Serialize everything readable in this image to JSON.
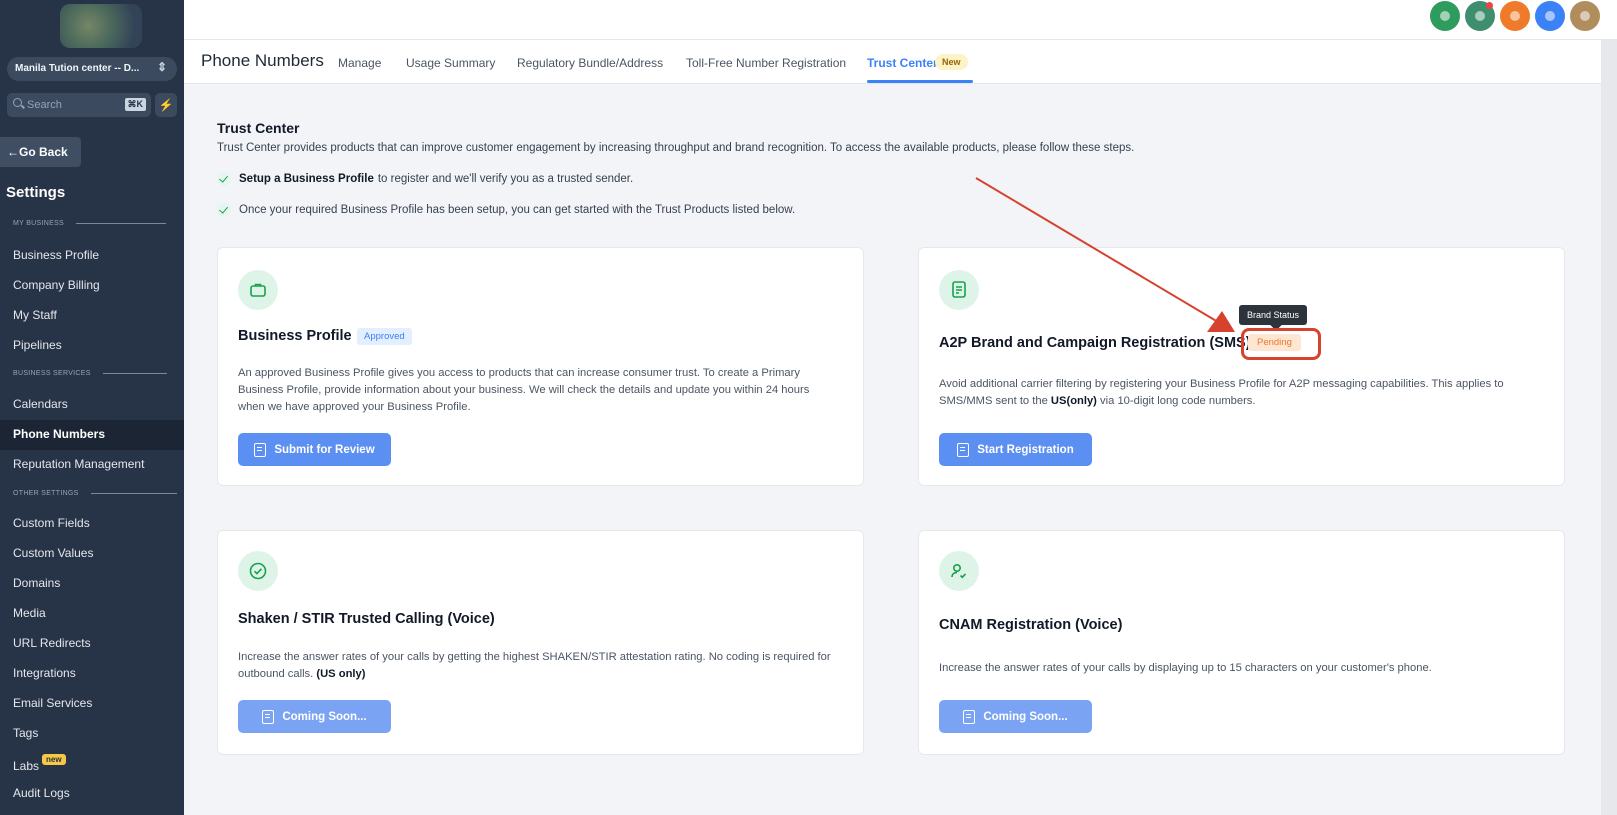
{
  "sidebar": {
    "account": "Manila Tution center -- D...",
    "search_placeholder": "Search",
    "search_shortcut": "⌘K",
    "go_back": "Go Back",
    "title": "Settings",
    "sections": {
      "my_business": "MY BUSINESS",
      "business_services": "BUSINESS SERVICES",
      "other_settings": "OTHER SETTINGS"
    },
    "items": [
      "Business Profile",
      "Company Billing",
      "My Staff",
      "Pipelines",
      "Calendars",
      "Phone Numbers",
      "Reputation Management",
      "Custom Fields",
      "Custom Values",
      "Domains",
      "Media",
      "URL Redirects",
      "Integrations",
      "Email Services",
      "Tags",
      "Labs",
      "Audit Logs"
    ],
    "labs_badge": "new",
    "active_item": "Phone Numbers"
  },
  "header": {
    "avatar_colors": [
      "#2e9c5e",
      "#3f8f6f",
      "#ef7a2a",
      "#3b82f6",
      "#b08d5c"
    ]
  },
  "nav": {
    "title": "Phone Numbers",
    "tabs": [
      "Manage",
      "Usage Summary",
      "Regulatory Bundle/Address",
      "Toll-Free Number Registration",
      "Trust Center"
    ],
    "active_tab": "Trust Center",
    "new_badge": "New"
  },
  "trust_center": {
    "title": "Trust Center",
    "description": "Trust Center provides products that can improve customer engagement by increasing throughput and brand recognition. To access the available products, please follow these steps.",
    "step1_bold": "Setup a Business Profile",
    "step1_rest": "to register and we'll verify you as a trusted sender.",
    "step2": "Once your required Business Profile has been setup, you can get started with the Trust Products listed below."
  },
  "cards": {
    "business_profile": {
      "title": "Business Profile",
      "badge": "Approved",
      "text": "An approved Business Profile gives you access to products that can increase consumer trust. To create a Primary Business Profile, provide information about your business. We will check the details and update you within 24 hours when we have approved your Business Profile.",
      "button": "Submit for Review"
    },
    "a2p": {
      "title": "A2P Brand and Campaign Registration (SMS)",
      "badge": "Pending",
      "tooltip": "Brand Status",
      "text_before": "Avoid additional carrier filtering by registering your Business Profile for A2P messaging capabilities. This applies to SMS/MMS sent to the",
      "text_bold": "US(only)",
      "text_after": "via 10-digit long code numbers.",
      "button": "Start Registration"
    },
    "shaken": {
      "title": "Shaken / STIR Trusted Calling (Voice)",
      "text_before": "Increase the answer rates of your calls by getting the highest SHAKEN/STIR attestation rating. No coding is required for outbound calls.",
      "text_bold": "(US only)",
      "button": "Coming Soon..."
    },
    "cnam": {
      "title": "CNAM Registration (Voice)",
      "text": "Increase the answer rates of your calls by displaying up to 15 characters on your customer's phone.",
      "button": "Coming Soon..."
    }
  },
  "annotation_color": "#d6422e"
}
